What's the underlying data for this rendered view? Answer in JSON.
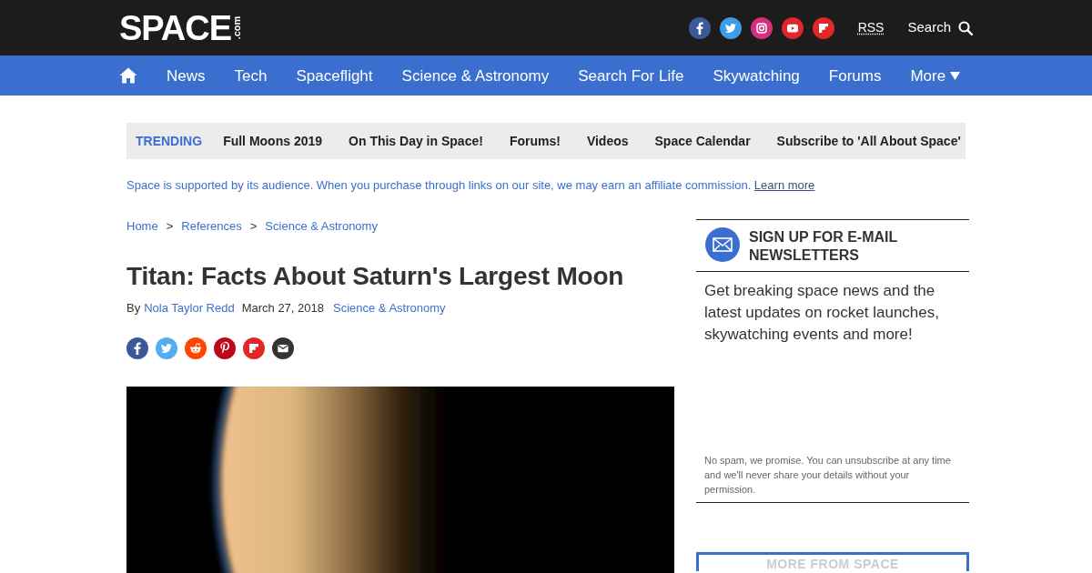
{
  "header": {
    "logo": {
      "text": "SPACE",
      "suffix": ".com"
    },
    "rss": "RSS",
    "search": "Search"
  },
  "nav": {
    "items": [
      "News",
      "Tech",
      "Spaceflight",
      "Science & Astronomy",
      "Search For Life",
      "Skywatching",
      "Forums"
    ],
    "more": "More"
  },
  "trending": {
    "label": "TRENDING",
    "items": [
      "Full Moons 2019",
      "On This Day in Space!",
      "Forums!",
      "Videos",
      "Space Calendar",
      "Subscribe to 'All About Space'"
    ]
  },
  "affiliate_notice": {
    "text": "Space is supported by its audience. When you purchase through links on our site, we may earn an affiliate commission.",
    "link": "Learn more"
  },
  "breadcrumb": {
    "items": [
      "Home",
      "References",
      "Science & Astronomy"
    ],
    "separators": [
      ">",
      ">"
    ]
  },
  "article": {
    "title": "Titan: Facts About Saturn's Largest Moon",
    "byline": {
      "prefix": "By",
      "author": "Nola Taylor Redd",
      "date": "March 27, 2018",
      "category": "Science & Astronomy"
    }
  },
  "newsletter": {
    "heading": "SIGN UP FOR E-MAIL NEWSLETTERS",
    "description": "Get breaking space news and the latest updates on rocket launches, skywatching events and more!",
    "disclaimer": "No spam, we promise. You can unsubscribe at any time and we'll never share your details without your permission."
  },
  "more_panel": {
    "heading": "MORE FROM SPACE"
  }
}
